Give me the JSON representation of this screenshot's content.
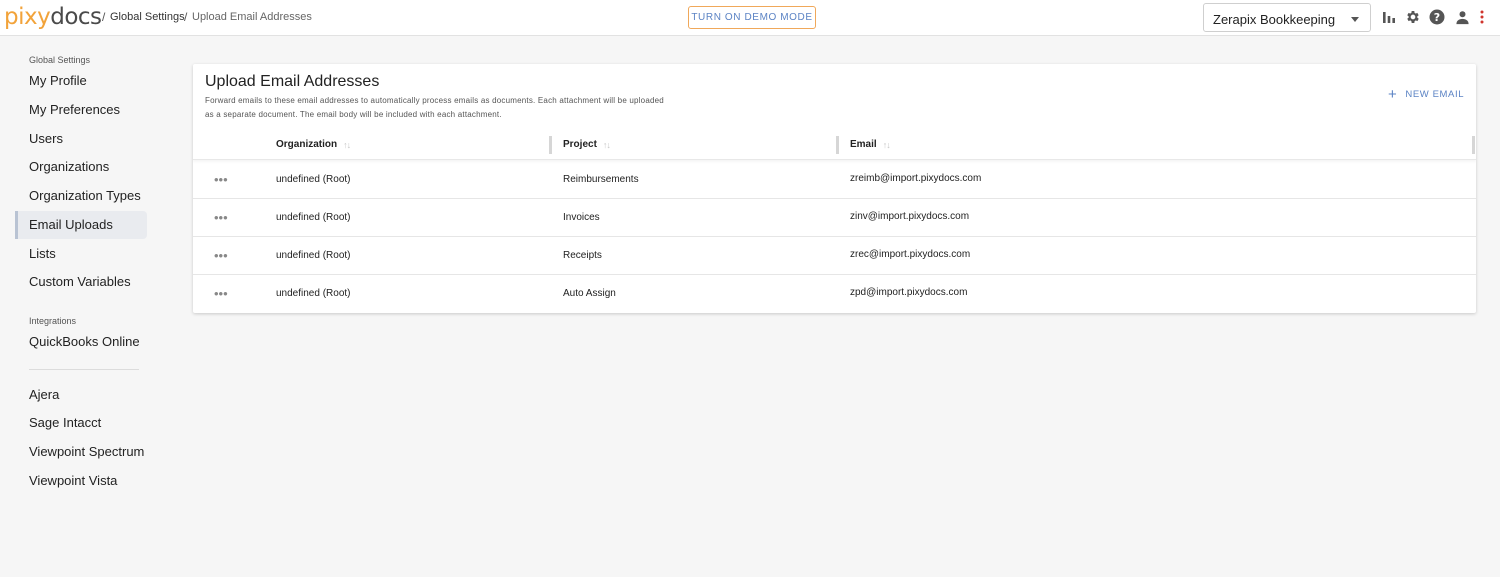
{
  "header": {
    "logo_part1": "pixy",
    "logo_part2": "docs",
    "breadcrumb": [
      "Global Settings",
      "Upload Email Addresses"
    ],
    "separator": "/",
    "demo_button": "TURN ON DEMO MODE",
    "org_select_value": "Zerapix Bookkeeping",
    "icons": [
      "bar-chart-icon",
      "gear-icon",
      "help-icon",
      "user-icon",
      "more-vert-icon"
    ],
    "accent_color": "#5b83c4",
    "brand_color": "#f2a33a"
  },
  "sidebar": {
    "section_global": "Global Settings",
    "items": [
      {
        "label": "My Profile"
      },
      {
        "label": "My Preferences"
      },
      {
        "label": "Users"
      },
      {
        "label": "Organizations"
      },
      {
        "label": "Organization Types"
      },
      {
        "label": "Email Uploads",
        "active": true
      },
      {
        "label": "Lists"
      },
      {
        "label": "Custom Variables"
      }
    ],
    "section_integrations": "Integrations",
    "integrations": [
      {
        "label": "QuickBooks Online"
      },
      {
        "label": "Ajera"
      },
      {
        "label": "Sage Intacct"
      },
      {
        "label": "Viewpoint Spectrum"
      },
      {
        "label": "Viewpoint Vista"
      }
    ]
  },
  "main": {
    "title": "Upload Email Addresses",
    "description": "Forward emails to these email addresses to automatically process emails as documents. Each attachment will be uploaded as a separate document. The email body will be included with each attachment.",
    "new_email_label": "NEW EMAIL",
    "columns": [
      "Organization",
      "Project",
      "Email"
    ],
    "sort_glyph": "↑↓",
    "row_menu_glyph": "•••",
    "rows": [
      {
        "organization": "undefined (Root)",
        "project": "Reimbursements",
        "email": "zreimb@import.pixydocs.com"
      },
      {
        "organization": "undefined (Root)",
        "project": "Invoices",
        "email": "zinv@import.pixydocs.com"
      },
      {
        "organization": "undefined (Root)",
        "project": "Receipts",
        "email": "zrec@import.pixydocs.com"
      },
      {
        "organization": "undefined (Root)",
        "project": "Auto Assign",
        "email": "zpd@import.pixydocs.com"
      }
    ]
  }
}
